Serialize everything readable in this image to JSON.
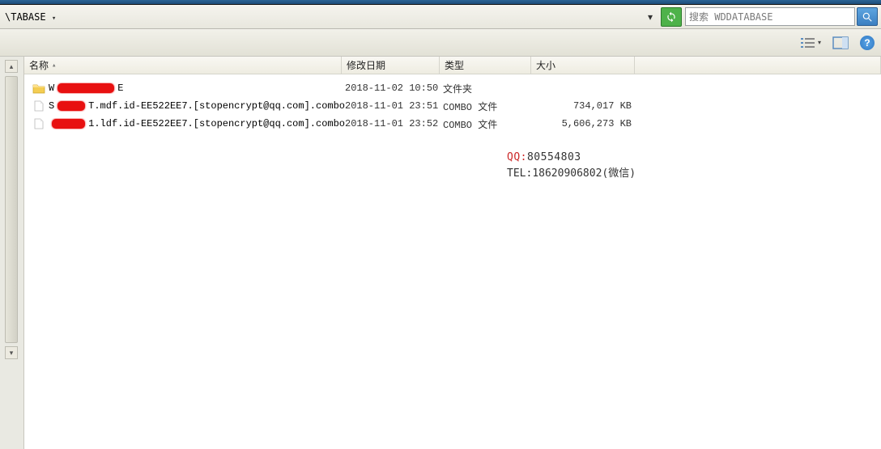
{
  "address": {
    "crumb": "\\TABASE",
    "search_placeholder": "搜索 WDDATABASE"
  },
  "columns": {
    "name": "名称",
    "date": "修改日期",
    "type": "类型",
    "size": "大小"
  },
  "files": [
    {
      "icon": "folder",
      "redact_width": 70,
      "prefix": "W",
      "suffix": "E",
      "date": "2018-11-02 10:50",
      "type": "文件夹",
      "size": ""
    },
    {
      "icon": "file",
      "redact_width": 54,
      "prefix": "S",
      "suffix": "T.mdf.id-EE522EE7.[stopencrypt@qq.com].combo",
      "date": "2018-11-01 23:51",
      "type": "COMBO 文件",
      "size": "734,017 KB"
    },
    {
      "icon": "file",
      "redact_width": 58,
      "prefix": "",
      "suffix": "1.ldf.id-EE522EE7.[stopencrypt@qq.com].combo",
      "date": "2018-11-01 23:52",
      "type": "COMBO 文件",
      "size": "5,606,273 KB"
    }
  ],
  "watermark": {
    "line1_prefix": "QQ:",
    "line1_value": "80554803",
    "line2_prefix": "TEL:",
    "line2_value": "18620906802(微信)"
  }
}
